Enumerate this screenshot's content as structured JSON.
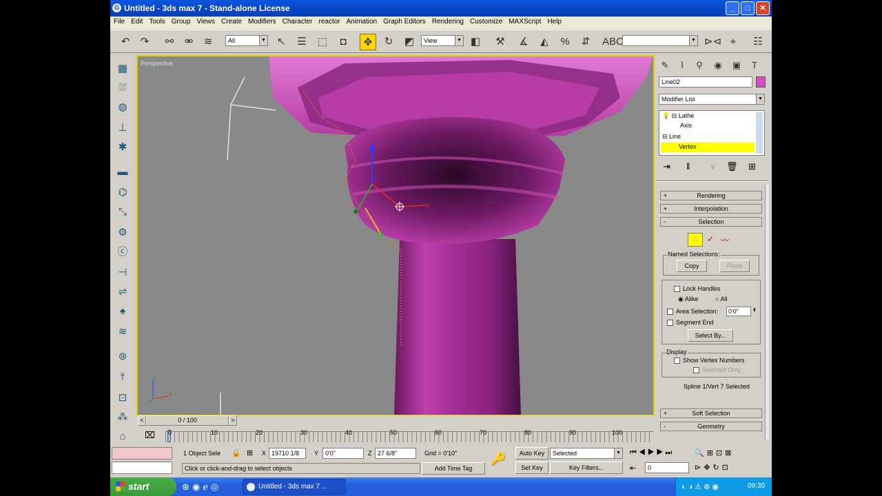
{
  "window": {
    "title": "Untitled - 3ds max 7 - Stand-alone License",
    "min": "_",
    "max": "□",
    "close": "✕"
  },
  "menu": [
    "File",
    "Edit",
    "Tools",
    "Group",
    "Views",
    "Create",
    "Modifiers",
    "Character",
    "reactor",
    "Animation",
    "Graph Editors",
    "Rendering",
    "Customize",
    "MAXScript",
    "Help"
  ],
  "toolbar": {
    "filter_value": "All",
    "ref_coord_value": "View",
    "named_sel_value": ""
  },
  "viewport": {
    "label": "Perspective",
    "axis_x": "x",
    "axis_z": "z"
  },
  "timeslider": {
    "label": "0 / 100",
    "prev": "<",
    "next": ">"
  },
  "trackbar": {
    "ticks": [
      "10",
      "20",
      "30",
      "40",
      "50",
      "60",
      "70",
      "80",
      "90",
      "100"
    ],
    "start": "0"
  },
  "status": {
    "selection_count": "1 Object Sele",
    "x_label": "X",
    "x_value": "19710 1/8",
    "y_label": "Y",
    "y_value": "0'0\"",
    "z_label": "Z",
    "z_value": "27 6/8\"",
    "grid": "Grid = 0'10\"",
    "prompt": "Click or click-and-drag to select objects",
    "add_time_tag": "Add Time Tag",
    "auto_key": "Auto Key",
    "set_key": "Set Key",
    "key_mode_value": "Selected",
    "key_filters": "Key Filters...",
    "frame_value": "0"
  },
  "cmdpanel": {
    "object_name": "Line02",
    "object_color": "#d94fc4",
    "modifier_list": "Modifier List",
    "stack": [
      {
        "label": "Lathe",
        "level": 0
      },
      {
        "label": "Axis",
        "level": 1
      },
      {
        "label": "Line",
        "level": 0
      },
      {
        "label": "Vertex",
        "level": 1,
        "selected": true
      }
    ],
    "rollouts": {
      "rendering": "Rendering",
      "interpolation": "Interpolation",
      "selection": "Selection",
      "soft_selection": "Soft Selection",
      "geometry": "Geometry"
    },
    "selection": {
      "named_selections": "Named Selections:",
      "copy": "Copy",
      "paste": "Paste",
      "lock_handles": "Lock Handles",
      "alike": "Alike",
      "all": "All",
      "area_selection": "Area Selection:",
      "area_value": "0'0\"",
      "segment_end": "Segment End",
      "select_by": "Select By...",
      "display": "Display",
      "show_vertex_numbers": "Show Vertex Numbers",
      "selected_only": "Selected Only",
      "status": "Spline 1/Vert 7 Selected"
    }
  },
  "taskbar": {
    "start": "start",
    "task": "Untitled - 3ds max 7 ...",
    "clock": "09:30"
  },
  "colors": {
    "accent_yellow": "#ffd800",
    "object_magenta": "#c13fae",
    "viewport_bg": "#898989",
    "title_blue": "#0844c4"
  }
}
